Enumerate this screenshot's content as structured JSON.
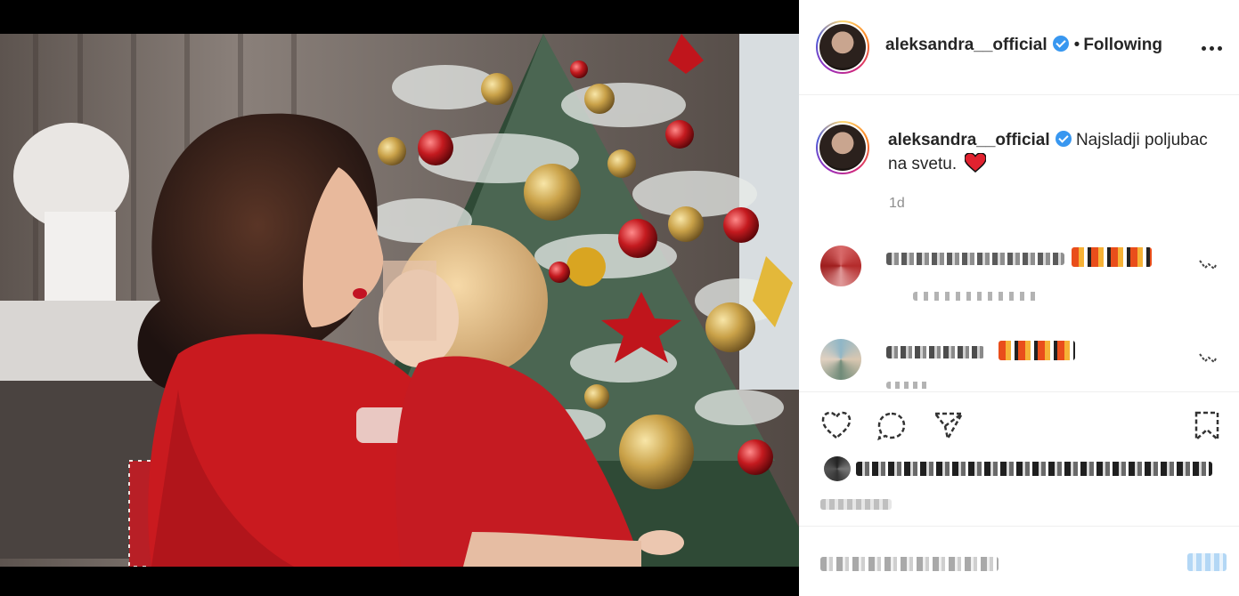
{
  "post": {
    "author": {
      "username": "aleksandra__official",
      "verified": true,
      "avatar_icon": "profile-photo"
    },
    "separator": "•",
    "follow_status": "Following",
    "more_icon": "more-horizontal-icon",
    "caption": {
      "username": "aleksandra__official",
      "text": "Najsladji poljubac na svetu.",
      "emoji": "red-heart"
    },
    "timestamp": "1d"
  },
  "photo": {
    "description_icon": "christmas-tree-photo",
    "subject": "mother-and-baby-kiss"
  },
  "comments": [
    {
      "avatar_icon": "blurred-avatar",
      "blurred": true
    },
    {
      "avatar_icon": "blurred-avatar",
      "blurred": true
    }
  ],
  "actions": {
    "like_icon": "heart-icon",
    "comment_icon": "comment-icon",
    "share_icon": "share-icon",
    "save_icon": "bookmark-icon"
  },
  "colors": {
    "verified_blue": "#3897f0",
    "text_primary": "#262626",
    "text_secondary": "#8e8e8e",
    "divider": "#efefef"
  }
}
